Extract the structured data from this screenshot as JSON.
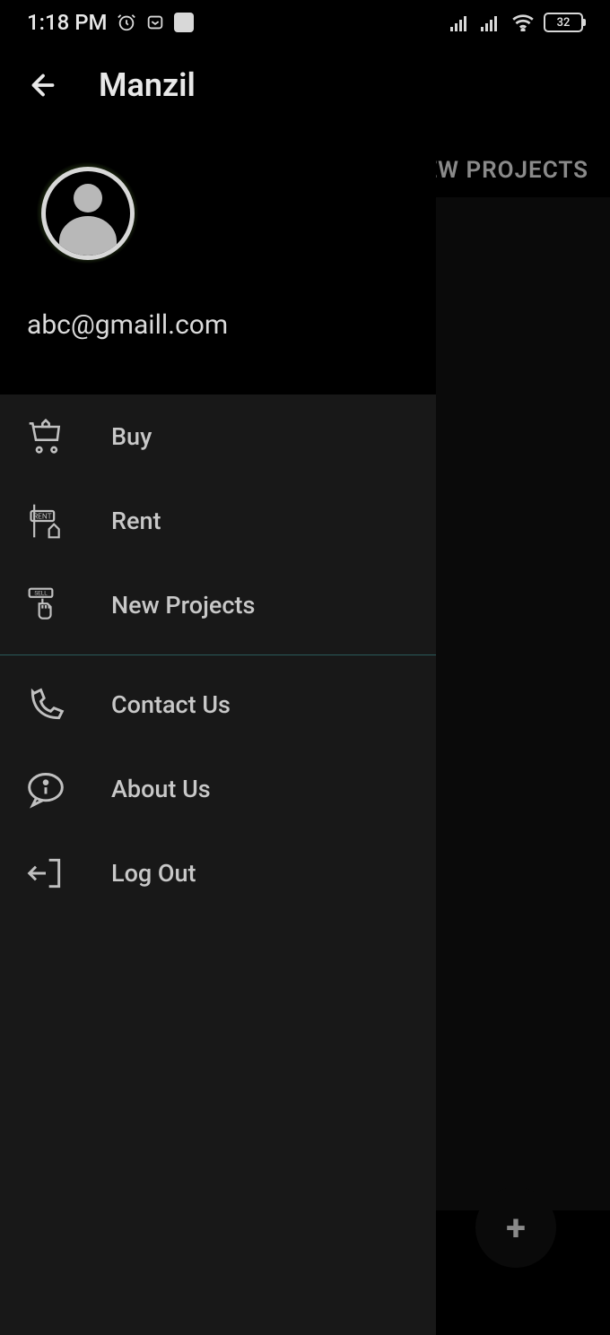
{
  "status": {
    "time": "1:18 PM",
    "battery": "32"
  },
  "header": {
    "title": "Manzil"
  },
  "background": {
    "tab": "NEW PROJECTS"
  },
  "drawer": {
    "email": "abc@gmaill.com",
    "menu_group1": [
      {
        "label": "Buy",
        "icon": "cart"
      },
      {
        "label": "Rent",
        "icon": "rent-sign"
      },
      {
        "label": "New Projects",
        "icon": "sell-hand"
      }
    ],
    "menu_group2": [
      {
        "label": "Contact Us",
        "icon": "phone"
      },
      {
        "label": "About Us",
        "icon": "info-bubble"
      },
      {
        "label": "Log Out",
        "icon": "logout"
      }
    ]
  },
  "fab": {
    "icon": "+"
  }
}
